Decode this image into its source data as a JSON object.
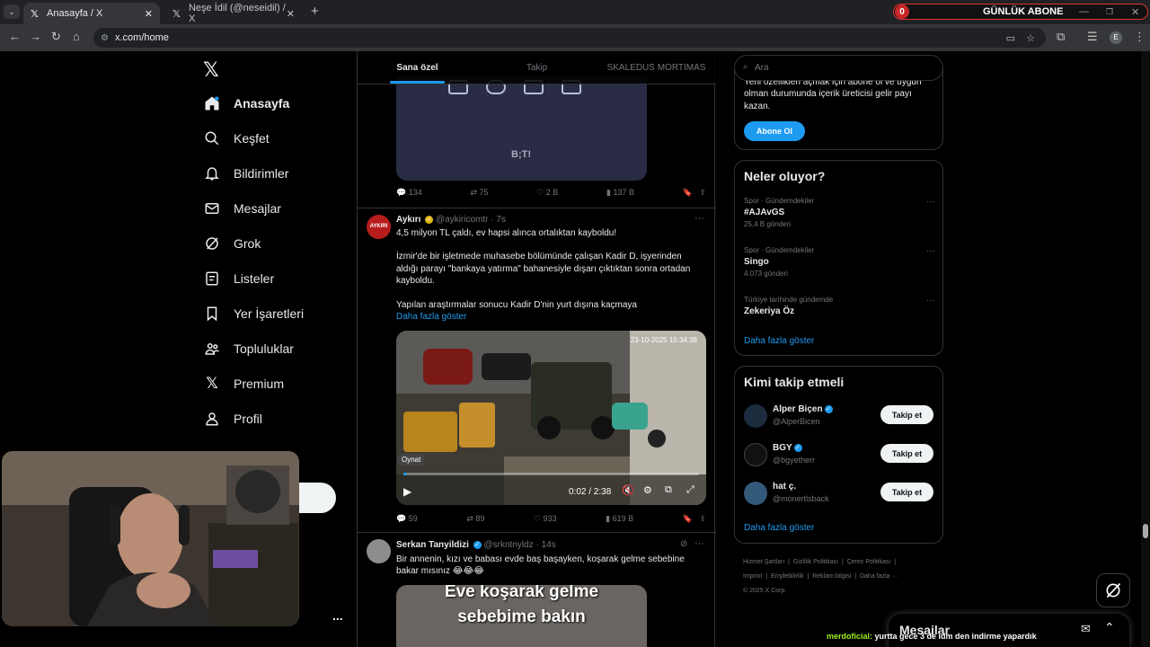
{
  "browser": {
    "tabs": [
      {
        "title": "Anasayfa / X"
      },
      {
        "title": "Neşe İdil (@neseidil) / X"
      }
    ],
    "new_tab": "+",
    "url": "x.com/home",
    "overlay_badge": {
      "count": "0",
      "label": "GÜNLÜK ABONE"
    }
  },
  "nav": {
    "items": [
      {
        "label": "Anasayfa"
      },
      {
        "label": "Keşfet"
      },
      {
        "label": "Bildirimler"
      },
      {
        "label": "Mesajlar"
      },
      {
        "label": "Grok"
      },
      {
        "label": "Listeler"
      },
      {
        "label": "Yer İşaretleri"
      },
      {
        "label": "Topluluklar"
      },
      {
        "label": "Premium"
      },
      {
        "label": "Profil"
      }
    ],
    "more": "..."
  },
  "feed": {
    "tabs": [
      "Sana özel",
      "Takip",
      "SKALEDUS MORTIMAS"
    ],
    "prev_post": {
      "image_logo": "B;T!",
      "replies": "134",
      "reposts": "75",
      "likes": "2 B",
      "views": "137 B"
    },
    "post1": {
      "author": "Aykırı",
      "handle": "@aykiricomtr",
      "time": "7s",
      "avatar_text": "AYKIRI",
      "text_lines": [
        "4,5 milyon TL çaldı, ev hapsi alınca ortalıktan kayboldu!",
        "",
        "İzmir'de bir işletmede muhasebe bölümünde çalışan Kadir D, işyerinden",
        "aldığı parayı \"bankaya yatırma\" bahanesiyle dışarı çıktıktan sonra ortadan",
        "kayboldu.",
        "",
        "Yapılan araştırmalar sonucu Kadir D'nin yurt dışına kaçmaya"
      ],
      "show_more": "Daha fazla göster",
      "video": {
        "timestamp": "23-10-2025 15:34:38",
        "tooltip": "Oynat",
        "time": "0:02 / 2:38",
        "progress": 0.013
      },
      "replies": "59",
      "reposts": "89",
      "likes": "933",
      "views": "619 B"
    },
    "post2": {
      "author": "Serkan Tanyildizi",
      "handle": "@srkntnyldz",
      "time": "14s",
      "text_lines": [
        "Bir annenin, kızı ve babası evde baş başayken, koşarak gelme sebebine",
        "bakar mısınız 😂😂😂"
      ],
      "image_caption_lines": [
        "Eve koşarak gelme",
        "sebebime bakın"
      ]
    }
  },
  "search": {
    "placeholder": "Ara"
  },
  "premium_card": {
    "text_lines": [
      "Yeni özellikleri açmak için abone ol ve uygun",
      "olman durumunda içerik üreticisi gelir payı",
      "kazan."
    ],
    "button": "Abone Ol"
  },
  "trends": {
    "title": "Neler oluyor?",
    "items": [
      {
        "context": "Spor · Gündemdekiler",
        "name": "#AJAvGS",
        "count": "25,4 B gönderi"
      },
      {
        "context": "Spor · Gündemdekiler",
        "name": "Singo",
        "count": "4.073 gönderi"
      },
      {
        "context": "Türkiye tarihinde gündemde",
        "name": "Zekeriya Öz",
        "count": ""
      }
    ],
    "show_more": "Daha fazla göster"
  },
  "who_to_follow": {
    "title": "Kimi takip etmeli",
    "users": [
      {
        "name": "Alper Biçen",
        "handle": "@AlperBicen",
        "button": "Takip et"
      },
      {
        "name": "BGY",
        "handle": "@bgyetherr",
        "button": "Takip et"
      },
      {
        "name": "hat ç.",
        "handle": "@monertlsback",
        "button": "Takip et"
      }
    ],
    "show_more": "Daha fazla göster"
  },
  "footer": {
    "links": [
      "Hizmet Şartları",
      "Gizlilik Politikası",
      "Çerez Politikası",
      "Imprint",
      "Erişilebilirlik",
      "Reklam bilgisi",
      "Daha fazla ···"
    ],
    "copyright": "© 2025 X Corp."
  },
  "messages_drawer": {
    "title": "Mesajlar"
  },
  "chat_overlay": {
    "user": "merdoficial:",
    "message": "yurtta gece 3 de idm den indirme yapardık"
  }
}
